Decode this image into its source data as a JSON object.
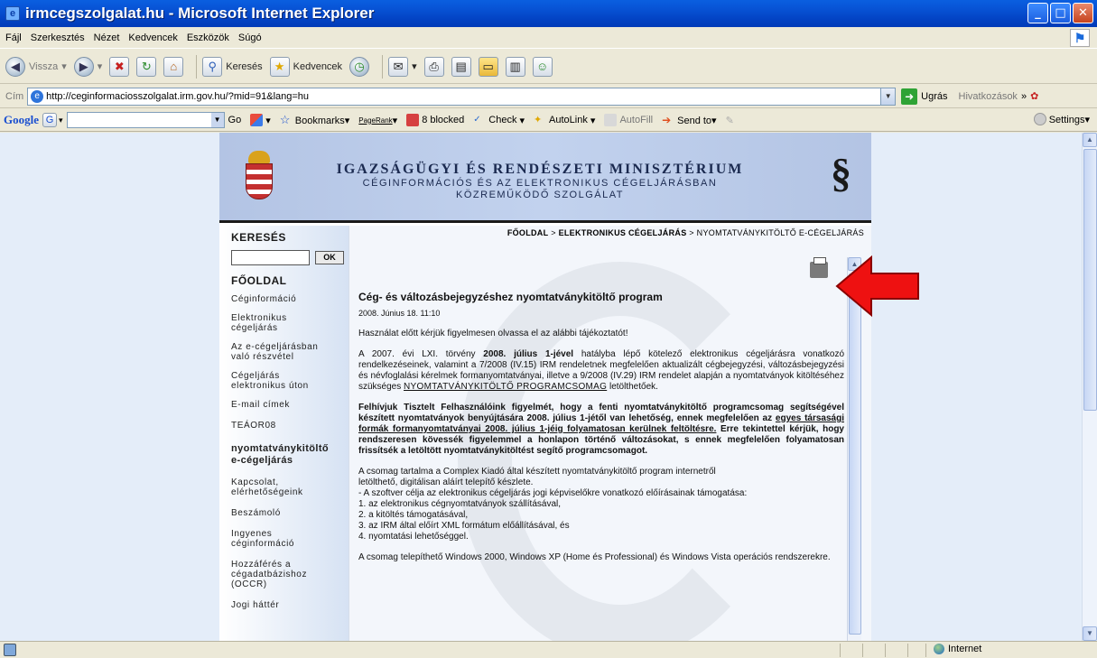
{
  "window": {
    "title": "irmcegszolgalat.hu - Microsoft Internet Explorer",
    "app_icon": "e",
    "buttons": {
      "minimize": "_",
      "maximize": "□",
      "close": "✕"
    }
  },
  "menu": {
    "items": [
      "Fájl",
      "Szerkesztés",
      "Nézet",
      "Kedvencek",
      "Eszközök",
      "Súgó"
    ]
  },
  "toolbar": {
    "back": "Vissza",
    "search": "Keresés",
    "favorites": "Kedvencek"
  },
  "address": {
    "label": "Cím",
    "url": "http://ceginformaciosszolgalat.irm.gov.hu/?mid=91&lang=hu",
    "go": "Ugrás",
    "links": "Hivatkozások",
    "links_chevron": "»"
  },
  "google_bar": {
    "logo": "Google",
    "go": "Go",
    "bookmarks": "Bookmarks▾",
    "pagerank": "PageRank",
    "blocked": "8 blocked",
    "check": "Check",
    "autolink": "AutoLink",
    "autofill": "AutoFill",
    "send_to": "Send to▾",
    "settings": "Settings▾"
  },
  "header": {
    "line1": "IGAZSÁGÜGYI ÉS RENDÉSZETI MINISZTÉRIUM",
    "line2": "CÉGINFORMÁCIÓS ÉS AZ ELEKTRONIKUS CÉGELJÁRÁSBAN",
    "line3": "KÖZREMŰKÖDŐ SZOLGÁLAT",
    "section_sign": "§"
  },
  "sidebar": {
    "search_title": "KERESÉS",
    "ok": "OK",
    "home": "FŐOLDAL",
    "items": [
      "Céginformáció",
      "Elektronikus\ncégeljárás",
      "Az e-cégeljárásban\nvaló részvétel",
      "Cégeljárás\nelektronikus úton",
      "E-mail címek",
      "TEÁOR08",
      "nyomtatványkitöltő\ne-cégeljárás",
      "Kapcsolat,\nelérhetőségeink",
      "Beszámoló",
      "Ingyenes\ncéginformáció",
      "Hozzáférés a\ncégadatbázishoz\n(OCCR)",
      "Jogi háttér"
    ]
  },
  "breadcrumb": {
    "home": "FŐOLDAL",
    "sep1": " > ",
    "section": "ELEKTRONIKUS CÉGELJÁRÁS",
    "sep2": " > ",
    "current": "NYOMTATVÁNYKITÖLTŐ E-CÉGELJÁRÁS"
  },
  "article": {
    "title": "Cég- és változásbejegyzéshez nyomtatványkitöltő program",
    "date": "2008. Június 18. 11:10",
    "intro": "Használat előtt kérjük figyelmesen olvassa el az alábbi tájékoztatót!",
    "p1_a": "A 2007. évi LXI. törvény ",
    "p1_b": "2008. július 1-jével",
    "p1_c": " hatályba lépő kötelező elektronikus cégeljárásra vonatkozó rendelkezéseinek, valamint a 7/2008 (IV.15) IRM rendeletnek megfelelően aktualizált cégbejegyzési, változásbejegyzési és névfoglalási kérelmek formanyomtatványai, illetve a 9/2008 (IV.29) IRM rendelet alapján a nyomtatványok kitöltéséhez szükséges ",
    "p1_link": "NYOMTATVÁNYKITÖLTŐ PROGRAMCSOMAG",
    "p1_d": " letölthetőek.",
    "p2_a": "Felhívjuk Tisztelt Felhasználóink figyelmét, hogy a fenti nyomtatványkitöltő programcsomag segítségével készített nyomtatványok benyújtására 2008. július 1-jétől van lehetőség, ennek megfelelően az ",
    "p2_link": "egyes társasági formák formanyomtatványai 2008. július 1-jéig folyamatosan kerülnek feltöltésre.",
    "p2_b": " Erre tekintettel kérjük, hogy rendszeresen kövessék figyelemmel a honlapon történő változásokat, s ennek megfelelően folyamatosan frissítsék a letöltött nyomtatványkitöltést segítő programcsomagot.",
    "p3": [
      "A csomag tartalma a Complex Kiadó által készített nyomtatványkitöltő program internetről",
      "letölthető, digitálisan aláírt telepítő készlete.",
      "- A szoftver célja az elektronikus cégeljárás jogi képviselőkre vonatkozó előírásainak támogatása:",
      "1. az elektronikus cégnyomtatványok szállításával,",
      "2. a kitöltés támogatásával,",
      "3. az IRM által előírt XML formátum előállításával, és",
      "4. nyomtatási lehetőséggel."
    ],
    "p4": "A csomag telepíthető Windows 2000, Windows XP (Home és Professional) és Windows Vista operációs rendszerekre."
  },
  "status": {
    "zone": "Internet"
  }
}
